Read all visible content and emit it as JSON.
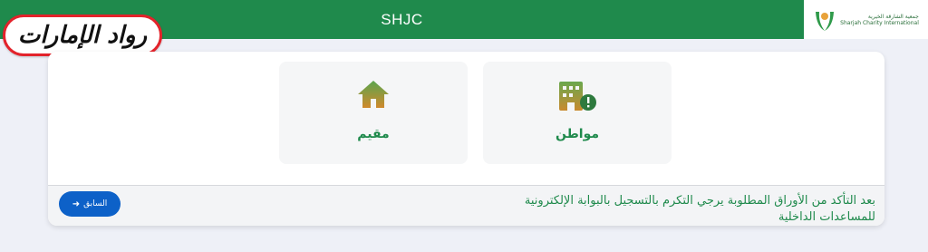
{
  "header": {
    "title": "SHJC",
    "logo_text_line1": "جمعية الشارقة الخيرية",
    "logo_text_line2": "Sharjah Charity International"
  },
  "watermark": {
    "text": "رواد الإمارات"
  },
  "tiles": [
    {
      "label": "مواطن",
      "icon": "building-alert-icon"
    },
    {
      "label": "مقيم",
      "icon": "home-icon"
    }
  ],
  "footer": {
    "message_line1": "بعد التأكد من الأوراق المطلوبة يرجي التكرم بالتسجيل بالبوابة الإلكترونية",
    "message_line2": "للمساعدات الداخلية",
    "prev_label": "السابق"
  },
  "colors": {
    "brand_green": "#1f8a4c",
    "button_blue": "#0d61c8",
    "watermark_red": "#e3232b"
  }
}
